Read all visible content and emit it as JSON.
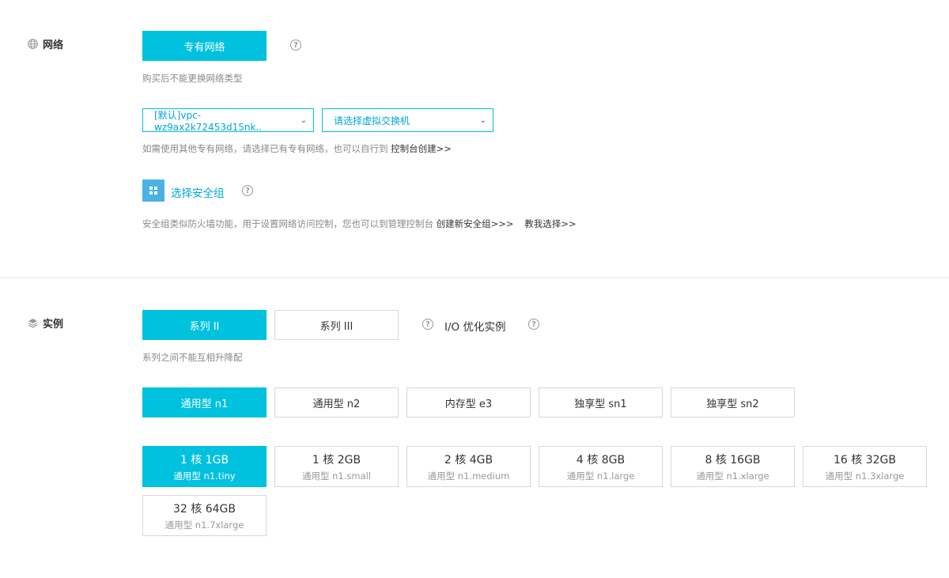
{
  "network": {
    "section_title": "网络",
    "type_button": "专有网络",
    "type_hint": "购买后不能更换网络类型",
    "vpc_select": "[默认]vpc-wz9ax2k72453d15nk..",
    "vswitch_select": "请选择虚拟交换机",
    "vpc_hint": "如需使用其他专有网络，请选择已有专有网络，也可以自行到",
    "vpc_hint_link": "控制台创建>>",
    "security_group_label": "选择安全组",
    "sg_hint": "安全组类似防火墙功能，用于设置网络访问控制，您也可以到管理控制台",
    "sg_create_link": "创建新安全组>>>",
    "sg_teach_link": "教我选择>>"
  },
  "instance": {
    "section_title": "实例",
    "series": [
      "系列 II",
      "系列 III"
    ],
    "io_label": "I/O 优化实例",
    "series_hint": "系列之间不能互相升降配",
    "families": [
      "通用型 n1",
      "通用型 n2",
      "内存型 e3",
      "独享型 sn1",
      "独享型 sn2"
    ],
    "specs": [
      {
        "title": "1 核 1GB",
        "sub": "通用型 n1.tiny"
      },
      {
        "title": "1 核 2GB",
        "sub": "通用型 n1.small"
      },
      {
        "title": "2 核 4GB",
        "sub": "通用型 n1.medium"
      },
      {
        "title": "4 核 8GB",
        "sub": "通用型 n1.large"
      },
      {
        "title": "8 核 16GB",
        "sub": "通用型 n1.xlarge"
      },
      {
        "title": "16 核 32GB",
        "sub": "通用型 n1.3xlarge"
      },
      {
        "title": "32 核 64GB",
        "sub": "通用型 n1.7xlarge"
      }
    ]
  },
  "colors": {
    "accent": "#00c1de",
    "border": "#d7d7d7",
    "hint": "#888888"
  },
  "icons": {
    "help": "question-circle-icon",
    "network": "globe-icon",
    "instance": "layers-icon",
    "security_group": "grid-icon"
  }
}
